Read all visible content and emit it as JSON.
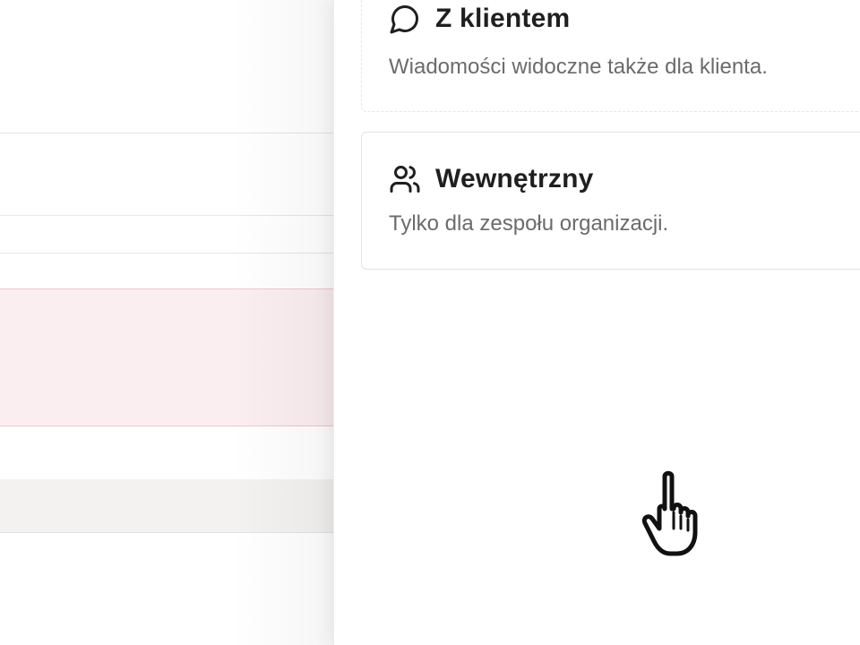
{
  "panel": {
    "options": [
      {
        "id": "client",
        "icon": "chat-bubble-icon",
        "title": "Z klientem",
        "description": "Wiadomości widoczne także dla klienta."
      },
      {
        "id": "internal",
        "icon": "users-icon",
        "title": "Wewnętrzny",
        "description": "Tylko dla zespołu organizacji."
      }
    ]
  },
  "cursor": {
    "icon": "hand-pointer-cursor-icon"
  },
  "colors": {
    "title_text": "#1f1f1f",
    "description_text": "#6b6b6b",
    "card_border": "#e3e3e3",
    "background_highlight": "#fbeef0",
    "background_highlight_border": "#f0c6cc",
    "background_row": "#f3f2f1"
  }
}
